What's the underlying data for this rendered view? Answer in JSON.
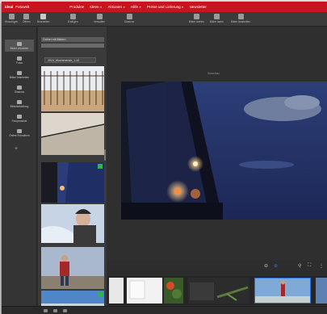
{
  "menubar": {
    "brand": "ideal",
    "app": "Fotowelt",
    "items": [
      {
        "label": "Produkte",
        "dropdown": false
      },
      {
        "label": "Ideen",
        "dropdown": true
      },
      {
        "label": "Aktionen",
        "dropdown": true
      },
      {
        "label": "Hilfe",
        "dropdown": true
      },
      {
        "label": "Preise und Lieferung",
        "dropdown": true
      },
      {
        "label": "Newsletter",
        "dropdown": false
      }
    ]
  },
  "toolbar": {
    "buttons": [
      {
        "label": "Hinzufügen"
      },
      {
        "label": "Öffnen"
      },
      {
        "label": "Bearbeiten"
      },
      {
        "label": "Einfügen"
      },
      {
        "label": "Verwalten"
      },
      {
        "label": "Diashow"
      },
      {
        "label": "Bilder drehen"
      },
      {
        "label": "Bilder laden"
      },
      {
        "label": "Bilder bearbeiten"
      }
    ]
  },
  "leftnav": {
    "items": [
      {
        "label": "Bilder verwalten",
        "icon": "folder-icon"
      },
      {
        "label": "Fotos",
        "icon": "photo-icon"
      },
      {
        "label": "Bilder bearbeiten",
        "icon": "edit-icon"
      },
      {
        "label": "Diashow",
        "icon": "slideshow-icon"
      },
      {
        "label": "Bilderbestellung",
        "icon": "cart-icon"
      },
      {
        "label": "Fotoprodukte",
        "icon": "book-icon"
      },
      {
        "label": "Online-Fotoalbum",
        "icon": "cloud-icon"
      }
    ]
  },
  "browser": {
    "folder_path": "Ordner mit Bildern",
    "folder_name": "2019_Wochenende_1-10"
  },
  "viewer": {
    "tab_label": "Vorschau"
  },
  "colors": {
    "accent_red": "#c6151c",
    "panel_dark": "#2d2d2d",
    "highlight_blue": "#2a6fdb"
  }
}
